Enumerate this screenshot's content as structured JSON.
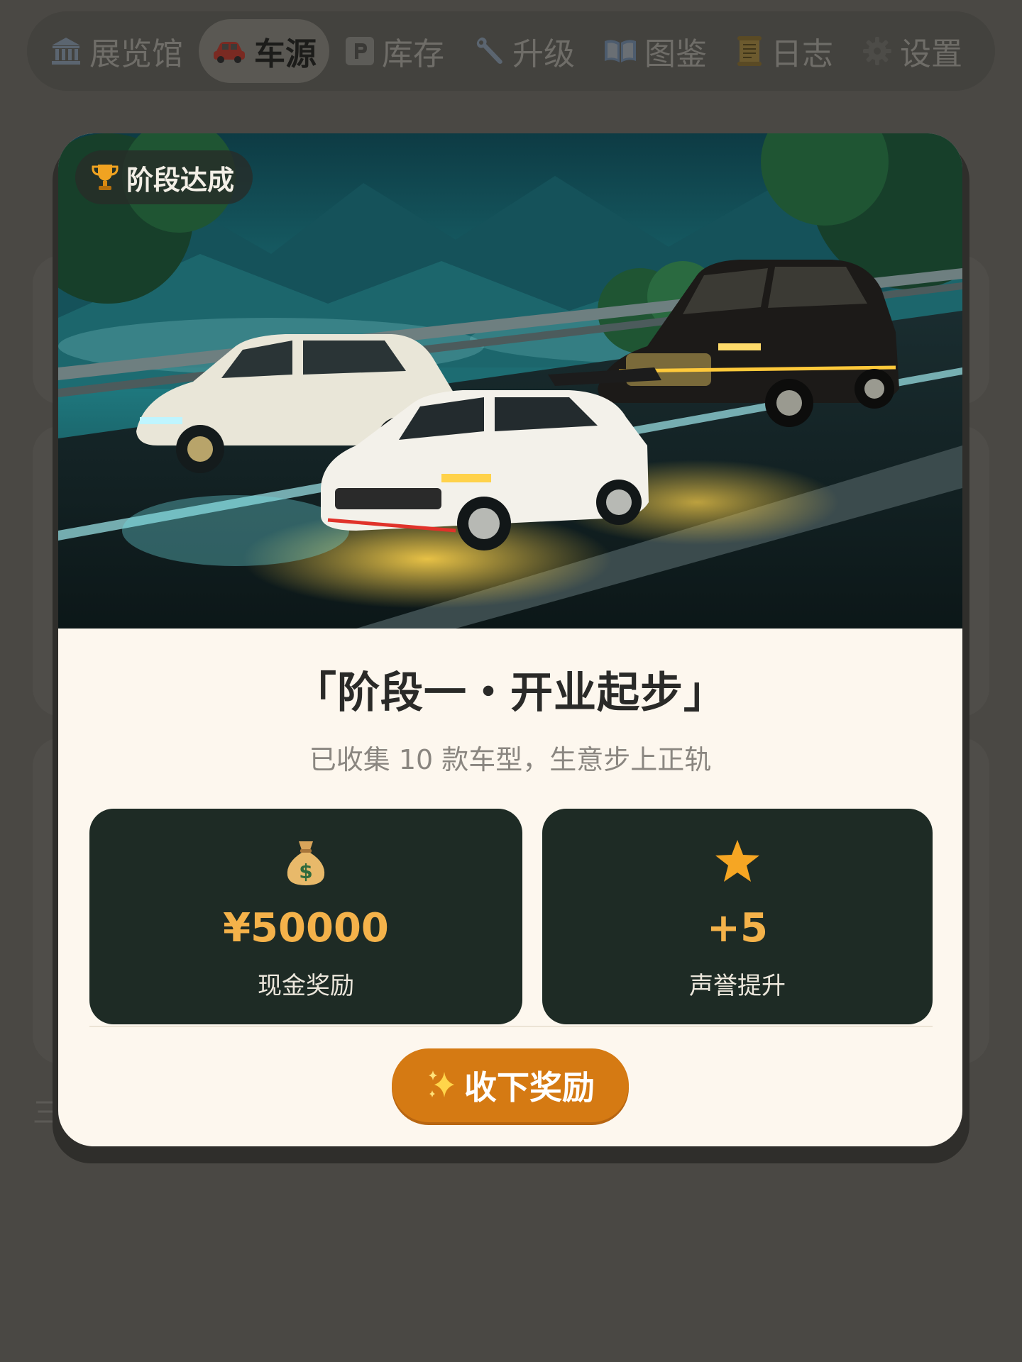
{
  "nav": {
    "items": [
      {
        "label": "展览馆",
        "icon": "museum-icon",
        "active": false
      },
      {
        "label": "车源",
        "icon": "car-icon",
        "active": true
      },
      {
        "label": "库存",
        "icon": "parking-icon",
        "active": false
      },
      {
        "label": "升级",
        "icon": "wrench-icon",
        "active": false
      },
      {
        "label": "图鉴",
        "icon": "book-icon",
        "active": false
      },
      {
        "label": "日志",
        "icon": "scroll-icon",
        "active": false
      },
      {
        "label": "设置",
        "icon": "gear-icon",
        "active": false
      }
    ]
  },
  "background": {
    "partial_text": "三"
  },
  "modal": {
    "badge": {
      "label": "阶段达成",
      "icon": "trophy-icon"
    },
    "hero_image": "pixel-art-three-cars-rainy-mountain-road",
    "title": "「阶段一・开业起步」",
    "subtitle": "已收集 10 款车型，生意步上正轨",
    "rewards": [
      {
        "icon": "money-bag-icon",
        "value": "¥50000",
        "label": "现金奖励"
      },
      {
        "icon": "star-icon",
        "value": "+5",
        "label": "声誉提升"
      }
    ],
    "claim_button": {
      "label": "收下奖励",
      "icon": "sparkle-icon"
    }
  },
  "colors": {
    "overlay": "#4a4844",
    "modal_bg": "#fdf7ee",
    "reward_card_bg": "#1e2b25",
    "reward_value": "#f4b24a",
    "button": "#d57a13"
  }
}
